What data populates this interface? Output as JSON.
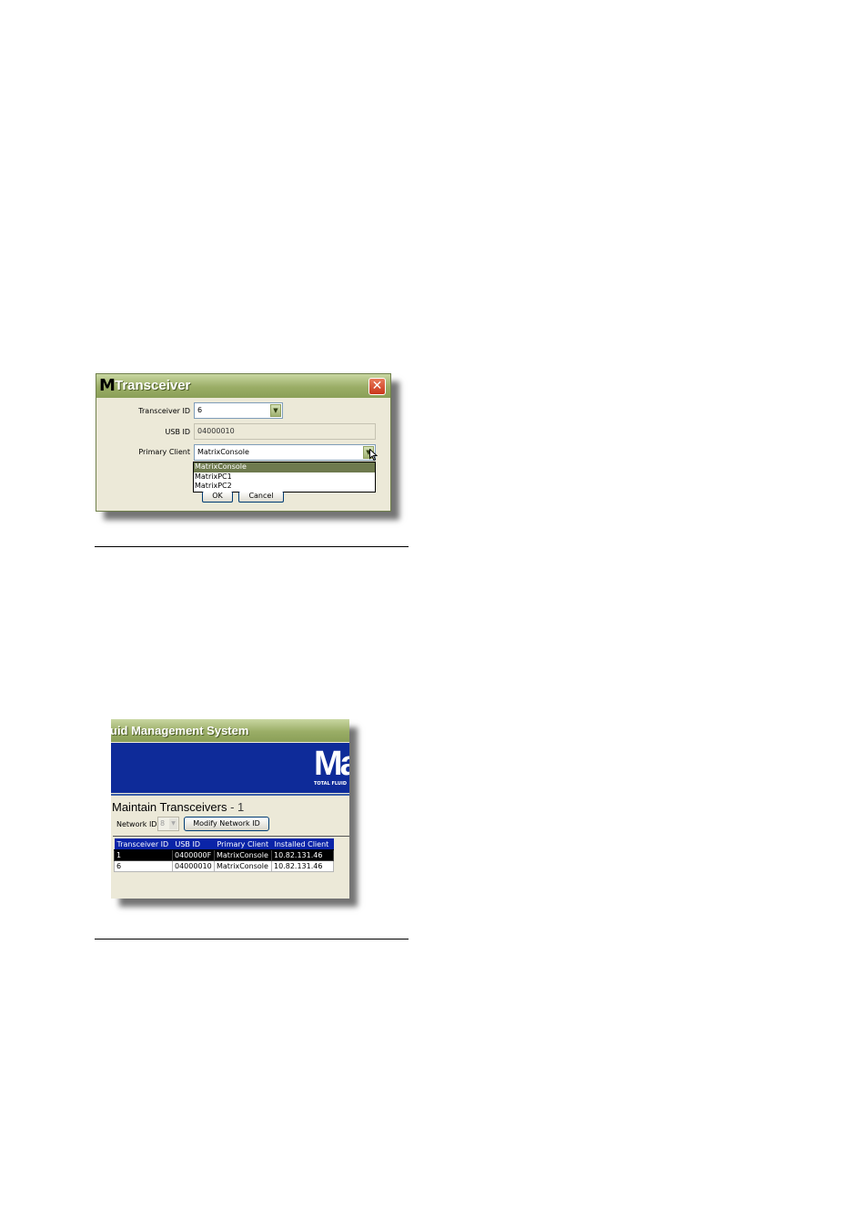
{
  "dialog": {
    "logo_letter": "M",
    "title": "Transceiver",
    "close_glyph": "✕",
    "transceiver_id_label": "Transceiver ID",
    "transceiver_id_value": "6",
    "usb_id_label": "USB ID",
    "usb_id_value": "04000010",
    "primary_client_label": "Primary Client",
    "primary_client_value": "MatrixConsole",
    "dropdown_options": [
      "MatrixConsole",
      "MatrixPC1",
      "MatrixPC2"
    ],
    "ok_label": "OK",
    "cancel_label": "Cancel"
  },
  "app": {
    "title": "uid Management System",
    "banner_logo": "Ma",
    "banner_tagline": "TOTAL FLUID",
    "page_title": "Maintain Transceivers",
    "page_count": " - 1",
    "network_id_label": "Network ID",
    "network_id_value": "8",
    "modify_button": "Modify Network ID",
    "columns": [
      "Transceiver ID",
      "USB ID",
      "Primary Client",
      "Installed Client"
    ],
    "rows": [
      [
        "1",
        "0400000F",
        "MatrixConsole",
        "10.82.131.46"
      ],
      [
        "6",
        "04000010",
        "MatrixConsole",
        "10.82.131.46"
      ]
    ]
  },
  "icons": {
    "dropdown_arrow": "chevron-down-icon",
    "cursor": "mouse-pointer-icon",
    "close": "close-icon"
  },
  "colors": {
    "title_bar": "#9aad66",
    "banner": "#0e2b99",
    "grid_header": "#0a24a8",
    "selection": "#6e7a4e"
  }
}
